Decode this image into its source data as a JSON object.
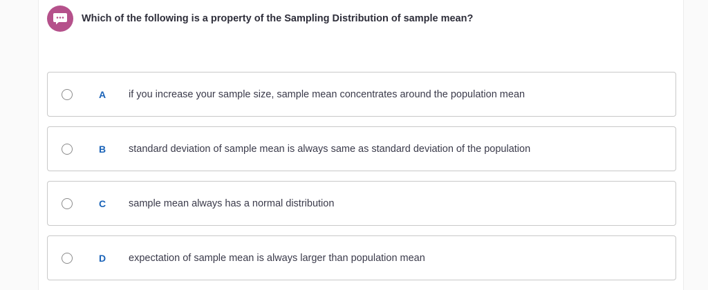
{
  "question": {
    "icon": "chat-bubble-icon",
    "text": "Which of the following is a property of the Sampling Distribution of sample mean?"
  },
  "options": [
    {
      "letter": "A",
      "text": "if you increase your sample size, sample mean concentrates around the population mean"
    },
    {
      "letter": "B",
      "text": "standard deviation of sample mean is always same as standard deviation of the population"
    },
    {
      "letter": "C",
      "text": "sample mean always has a normal distribution"
    },
    {
      "letter": "D",
      "text": "expectation of sample mean  is always larger than population mean"
    }
  ],
  "colors": {
    "accent": "#b5518b",
    "letter": "#1a63b8",
    "border": "#c8c8c8"
  }
}
